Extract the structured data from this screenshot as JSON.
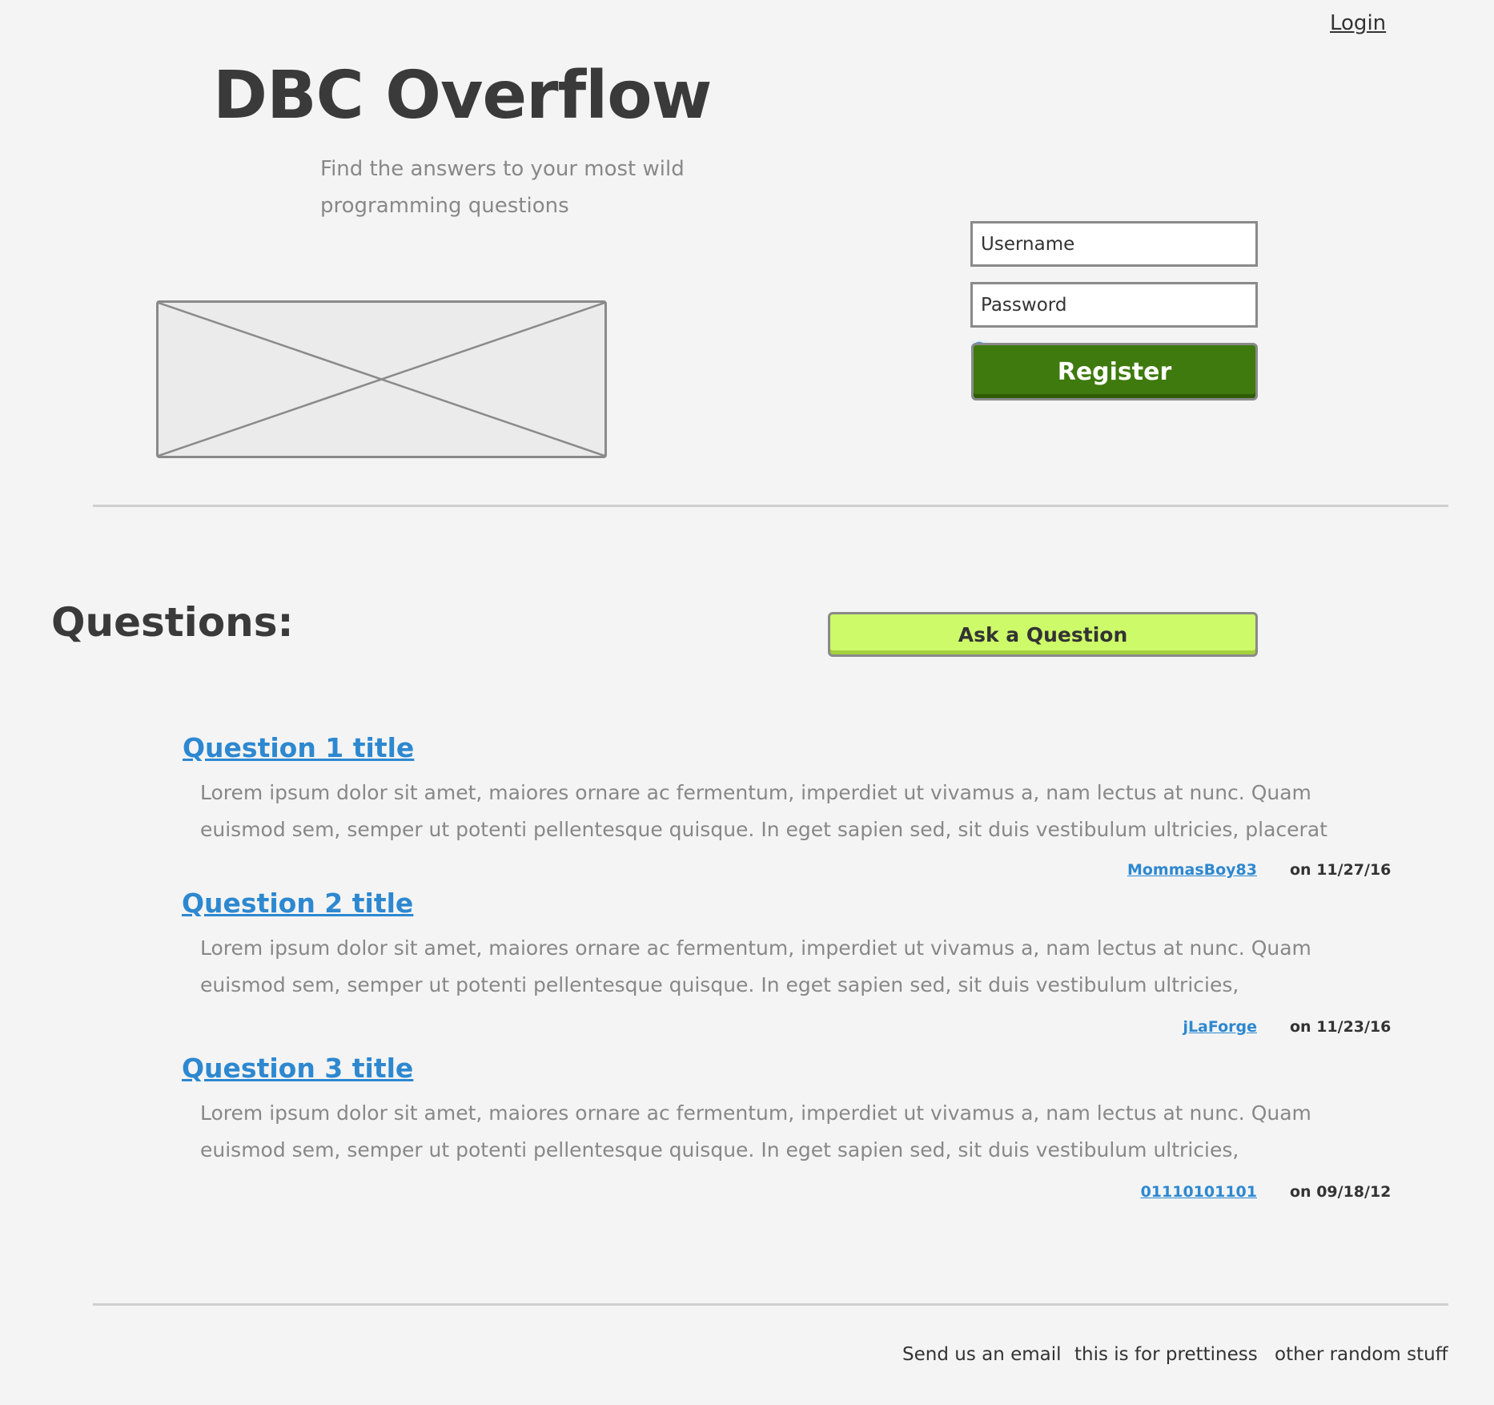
{
  "header": {
    "login_label": "Login",
    "title": "DBC Overflow",
    "tagline": "Find the answers to your most wild programming questions"
  },
  "auth": {
    "username_placeholder": "Username",
    "password_placeholder": "Password",
    "register_label": "Register",
    "register_color": "#3e7a0d"
  },
  "questions": {
    "heading": "Questions:",
    "ask_label": "Ask a Question",
    "ask_color": "#cdfa69",
    "items": [
      {
        "title": "Question 1 title",
        "body": "Lorem ipsum dolor sit amet, maiores ornare ac fermentum, imperdiet ut vivamus a, nam lectus at nunc. Quam euismod sem, semper ut potenti pellentesque quisque. In eget sapien sed, sit duis vestibulum ultricies, placerat",
        "author": "MommasBoy83",
        "date": "on 11/27/16"
      },
      {
        "title": "Question 2 title",
        "body": "Lorem ipsum dolor sit amet, maiores ornare ac fermentum, imperdiet ut vivamus a, nam lectus at nunc. Quam euismod sem, semper ut potenti pellentesque quisque. In eget sapien sed, sit duis vestibulum ultricies,",
        "author": "jLaForge",
        "date": "on 11/23/16"
      },
      {
        "title": "Question 3 title",
        "body": "Lorem ipsum dolor sit amet, maiores ornare ac fermentum, imperdiet ut vivamus a, nam lectus at nunc. Quam euismod sem, semper ut potenti pellentesque quisque. In eget sapien sed, sit duis vestibulum ultricies,",
        "author": "01110101101",
        "date": "on 09/18/12"
      }
    ]
  },
  "footer": {
    "links": [
      "Send us an email",
      "this is for prettiness",
      "other random stuff"
    ]
  },
  "colors": {
    "link": "#2d88d0",
    "background": "#f4f4f4",
    "text": "#333333"
  }
}
